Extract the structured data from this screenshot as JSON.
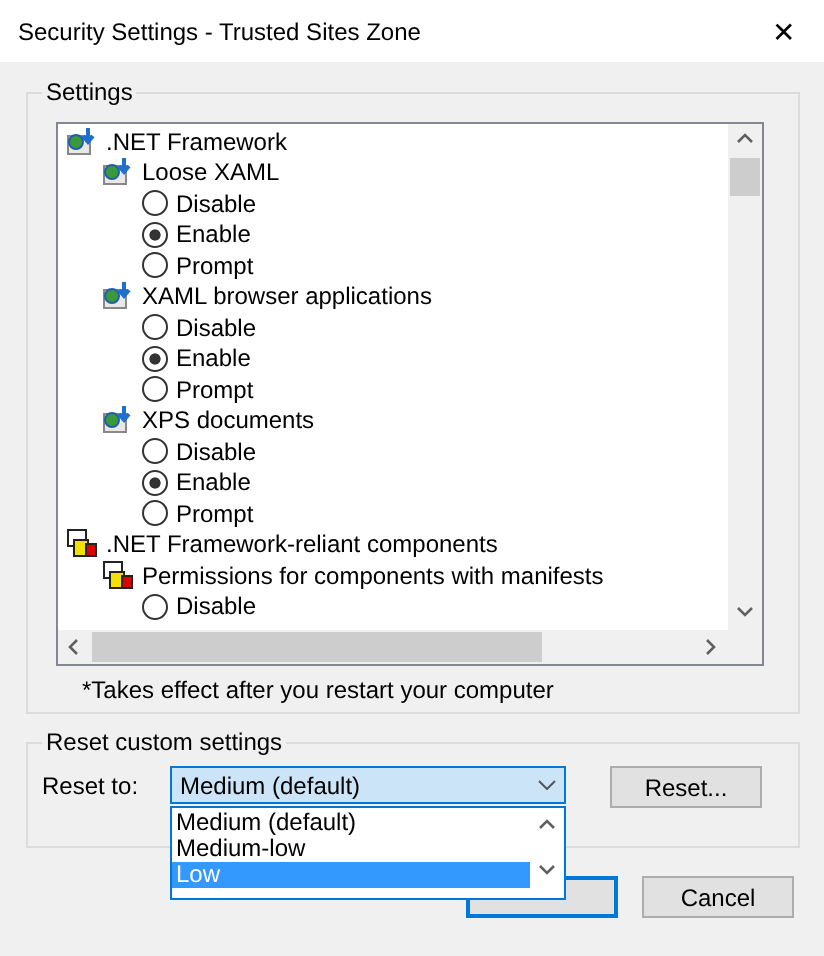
{
  "window": {
    "title": "Security Settings - Trusted Sites Zone",
    "close": "✕"
  },
  "settings": {
    "label": "Settings",
    "tree": [
      {
        "kind": "setting",
        "label": ".NET Framework",
        "children": [
          {
            "kind": "setting",
            "label": "Loose XAML",
            "children": [
              {
                "kind": "option",
                "label": "Disable",
                "selected": false
              },
              {
                "kind": "option",
                "label": "Enable",
                "selected": true
              },
              {
                "kind": "option",
                "label": "Prompt",
                "selected": false
              }
            ]
          },
          {
            "kind": "setting",
            "label": "XAML browser applications",
            "children": [
              {
                "kind": "option",
                "label": "Disable",
                "selected": false
              },
              {
                "kind": "option",
                "label": "Enable",
                "selected": true
              },
              {
                "kind": "option",
                "label": "Prompt",
                "selected": false
              }
            ]
          },
          {
            "kind": "setting",
            "label": "XPS documents",
            "children": [
              {
                "kind": "option",
                "label": "Disable",
                "selected": false
              },
              {
                "kind": "option",
                "label": "Enable",
                "selected": true
              },
              {
                "kind": "option",
                "label": "Prompt",
                "selected": false
              }
            ]
          }
        ]
      },
      {
        "kind": "component",
        "label": ".NET Framework-reliant components",
        "children": [
          {
            "kind": "component",
            "label": "Permissions for components with manifests",
            "children": [
              {
                "kind": "option",
                "label": "Disable",
                "selected": false
              }
            ]
          }
        ]
      }
    ],
    "note": "*Takes effect after you restart your computer"
  },
  "reset": {
    "label": "Reset custom settings",
    "field_label": "Reset to:",
    "value": "Medium (default)",
    "expanded": true,
    "options": [
      {
        "label": "Medium (default)",
        "highlighted": false
      },
      {
        "label": "Medium-low",
        "highlighted": false
      },
      {
        "label": "Low",
        "highlighted": true
      }
    ],
    "button": "Reset..."
  },
  "buttons": {
    "cancel": "Cancel"
  }
}
